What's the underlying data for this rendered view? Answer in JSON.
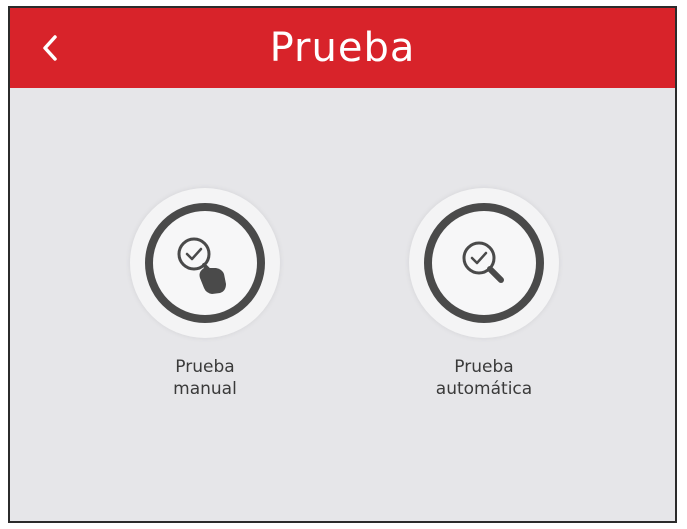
{
  "header": {
    "title": "Prueba",
    "back_icon": "chevron-left-icon",
    "background_color": "#d8232a"
  },
  "options": [
    {
      "label": "Prueba\nmanual",
      "icon": "manual-test-icon"
    },
    {
      "label": "Prueba\nautomática",
      "icon": "auto-test-icon"
    }
  ]
}
